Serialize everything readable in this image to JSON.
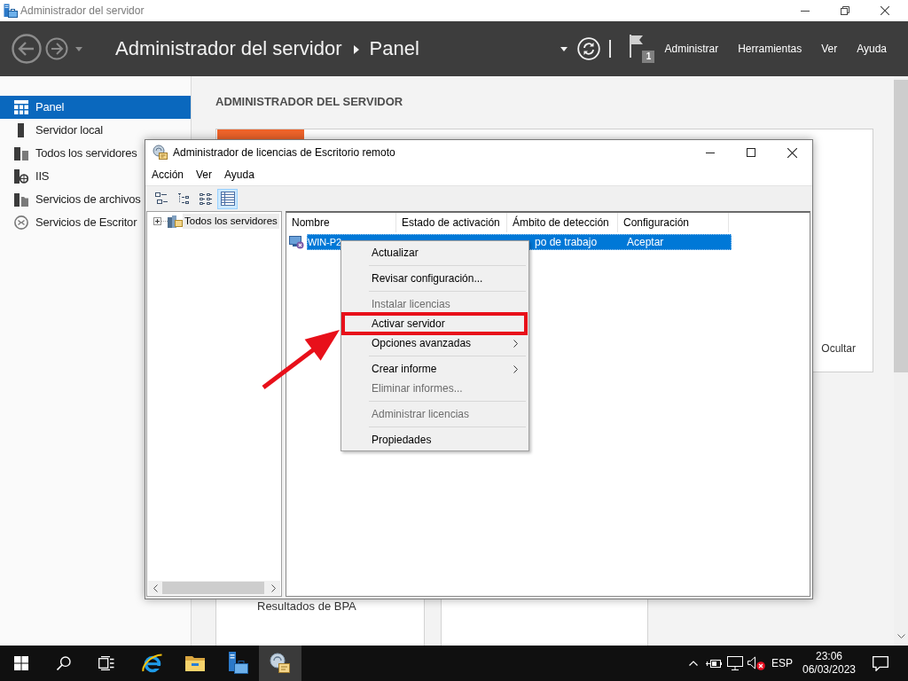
{
  "window": {
    "title": "Administrador del servidor"
  },
  "header": {
    "breadcrumb": [
      "Administrador del servidor",
      "Panel"
    ],
    "notification_badge": "1",
    "menu": [
      "Administrar",
      "Herramientas",
      "Ver",
      "Ayuda"
    ]
  },
  "sidebar": {
    "items": [
      {
        "kind": "dashboard",
        "label": "Panel",
        "selected": true
      },
      {
        "kind": "local-server",
        "label": "Servidor local",
        "selected": false
      },
      {
        "kind": "all-servers",
        "label": "Todos los servidores",
        "selected": false
      },
      {
        "kind": "iis",
        "label": "IIS",
        "selected": false
      },
      {
        "kind": "file-services",
        "label": "Servicios de archivos",
        "selected": false
      },
      {
        "kind": "remote-desktop",
        "label": "Servicios de Escritor",
        "selected": false
      }
    ]
  },
  "dashboard": {
    "heading": "ADMINISTRADOR DEL SERVIDOR",
    "hide_link": "Ocultar",
    "bpa_label": "Resultados de BPA"
  },
  "dialog": {
    "title": "Administrador de licencias de Escritorio remoto",
    "menu": [
      "Acción",
      "Ver",
      "Ayuda"
    ],
    "toolbar": [
      {
        "kind": "large-icons",
        "selected": false
      },
      {
        "kind": "small-icons",
        "selected": false
      },
      {
        "kind": "list",
        "selected": false
      },
      {
        "kind": "details",
        "selected": true
      }
    ],
    "tree": [
      {
        "label": "Todos los servidores",
        "expanded": false,
        "selected": true
      }
    ],
    "table": {
      "columns": [
        "Nombre",
        "Estado de activación",
        "Ámbito de detección",
        "Configuración"
      ],
      "rows": [
        {
          "name": "WIN-P2",
          "detection_scope": "po de trabajo",
          "configuration": "Aceptar",
          "selected": true
        }
      ]
    }
  },
  "context_menu": {
    "items": [
      {
        "kind": "item",
        "label": "Actualizar",
        "disabled": false,
        "submenu": false,
        "annotated": false
      },
      {
        "kind": "separator"
      },
      {
        "kind": "item",
        "label": "Revisar configuración...",
        "disabled": false,
        "submenu": false,
        "annotated": false
      },
      {
        "kind": "separator"
      },
      {
        "kind": "item",
        "label": "Instalar licencias",
        "disabled": true,
        "submenu": false,
        "annotated": false
      },
      {
        "kind": "item",
        "label": "Activar servidor",
        "disabled": false,
        "submenu": false,
        "annotated": true
      },
      {
        "kind": "item",
        "label": "Opciones avanzadas",
        "disabled": false,
        "submenu": true,
        "annotated": false
      },
      {
        "kind": "separator"
      },
      {
        "kind": "item",
        "label": "Crear informe",
        "disabled": false,
        "submenu": true,
        "annotated": false
      },
      {
        "kind": "item",
        "label": "Eliminar informes...",
        "disabled": true,
        "submenu": false,
        "annotated": false
      },
      {
        "kind": "separator"
      },
      {
        "kind": "item",
        "label": "Administrar licencias",
        "disabled": true,
        "submenu": false,
        "annotated": false
      },
      {
        "kind": "separator"
      },
      {
        "kind": "item",
        "label": "Propiedades",
        "disabled": false,
        "submenu": false,
        "annotated": false
      }
    ]
  },
  "taskbar": {
    "buttons": [
      {
        "kind": "start",
        "selected": false
      },
      {
        "kind": "search",
        "selected": false
      },
      {
        "kind": "task-view",
        "selected": false
      },
      {
        "kind": "browser",
        "selected": false
      },
      {
        "kind": "explorer",
        "selected": false
      },
      {
        "kind": "server-manager",
        "selected": false
      },
      {
        "kind": "license-manager",
        "selected": true
      }
    ],
    "tray": {
      "muted": true,
      "language": "ESP",
      "time": "23:06",
      "date": "06/03/2023"
    }
  }
}
